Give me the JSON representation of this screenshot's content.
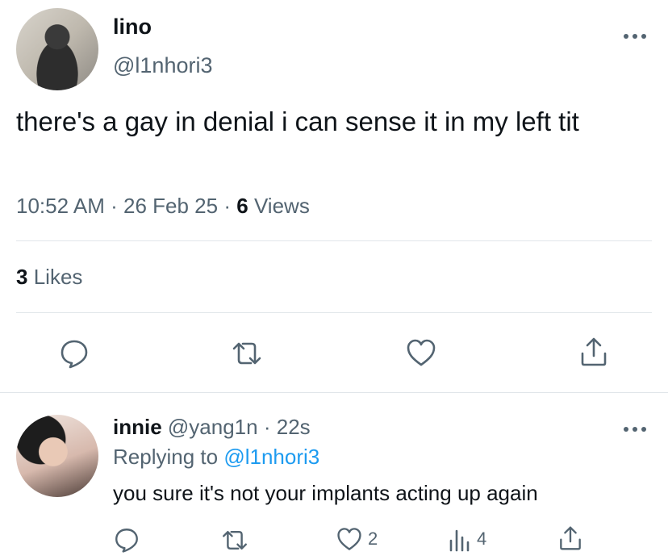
{
  "main_tweet": {
    "display_name": "lino",
    "handle": "@l1nhori3",
    "text": "there's a gay in denial i can sense it in my left tit",
    "time": "10:52 AM",
    "sep1": "·",
    "date": "26 Feb 25",
    "sep2": "·",
    "views_count": "6",
    "views_label": "Views",
    "likes_count": "3",
    "likes_label": "Likes"
  },
  "reply": {
    "display_name": "innie",
    "handle": "@yang1n",
    "sep": "·",
    "time": "22s",
    "replying_prefix": "Replying to",
    "replying_to": "@l1nhori3",
    "text": "you sure it's not your implants acting up again",
    "like_count": "2",
    "view_count": "4"
  },
  "icons": {
    "more": "more-horizontal-icon",
    "reply": "reply-bubble-icon",
    "retweet": "retweet-icon",
    "like": "heart-icon",
    "views": "views-bar-icon",
    "share": "share-upload-icon"
  },
  "colors": {
    "text": "#0f1419",
    "muted": "#536471",
    "link": "#1d9bf0",
    "divider": "#e1e6ea"
  }
}
